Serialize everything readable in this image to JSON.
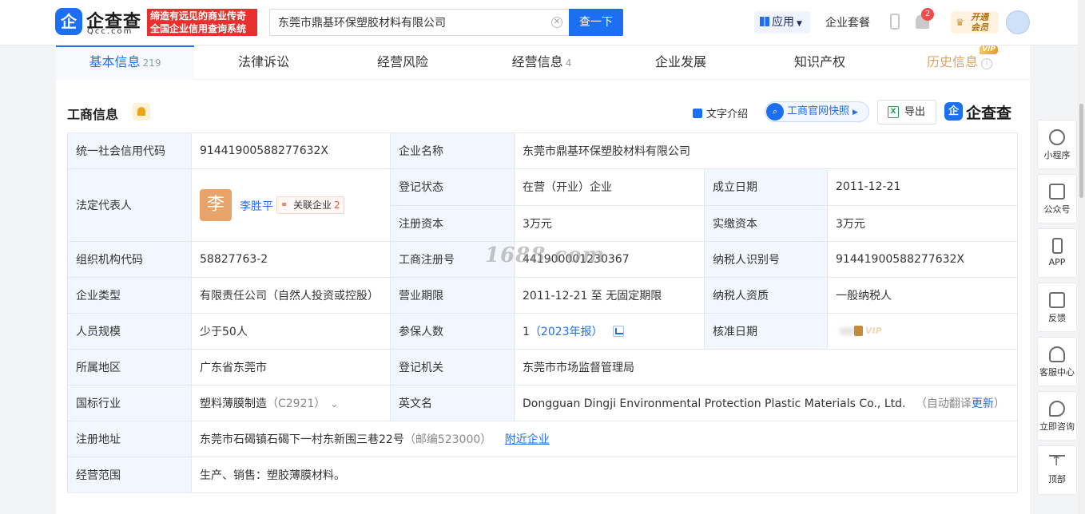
{
  "header": {
    "logo_badge": "企",
    "logo_name": "企查查",
    "logo_domain": "Qcc.com",
    "slogan_line1": "缔造有远见的商业传奇",
    "slogan_line2": "全国企业信用查询系统",
    "search_value": "东莞市鼎基环保塑胶材料有限公司",
    "search_button": "查一下",
    "apps_label": "应用",
    "package_label": "企业套餐",
    "notification_count": "2",
    "vip_line1": "开通",
    "vip_line2": "会员"
  },
  "tabs": [
    {
      "label": "基本信息",
      "count": "219"
    },
    {
      "label": "法律诉讼",
      "count": ""
    },
    {
      "label": "经营风险",
      "count": ""
    },
    {
      "label": "经营信息",
      "count": "4"
    },
    {
      "label": "企业发展",
      "count": ""
    },
    {
      "label": "知识产权",
      "count": ""
    },
    {
      "label": "历史信息",
      "count": "",
      "badge": "VIP"
    }
  ],
  "section": {
    "title": "工商信息",
    "text_intro": "文字介绍",
    "snapshot": "工商官网快照",
    "export": "导出",
    "brand": "企查查"
  },
  "table": {
    "credit_code_label": "统一社会信用代码",
    "credit_code": "91441900588277632X",
    "company_name_label": "企业名称",
    "company_name": "东莞市鼎基环保塑胶材料有限公司",
    "legal_rep_label": "法定代表人",
    "legal_rep_avatar": "李",
    "legal_rep_name": "李胜平",
    "related_label": "关联企业",
    "related_count": "2",
    "reg_status_label": "登记状态",
    "reg_status": "在营（开业）企业",
    "est_date_label": "成立日期",
    "est_date": "2011-12-21",
    "reg_capital_label": "注册资本",
    "reg_capital": "3万元",
    "paid_capital_label": "实缴资本",
    "paid_capital": "3万元",
    "org_code_label": "组织机构代码",
    "org_code": "58827763-2",
    "biz_reg_no_label": "工商注册号",
    "biz_reg_no": "441900001230367",
    "taxpayer_id_label": "纳税人识别号",
    "taxpayer_id": "91441900588277632X",
    "company_type_label": "企业类型",
    "company_type": "有限责任公司（自然人投资或控股）",
    "biz_term_label": "营业期限",
    "biz_term": "2011-12-21 至 无固定期限",
    "taxpayer_qual_label": "纳税人资质",
    "taxpayer_qual": "一般纳税人",
    "staff_size_label": "人员规模",
    "staff_size": "少于50人",
    "insured_label": "参保人数",
    "insured_count": "1",
    "insured_year": "（2023年报）",
    "approval_date_label": "核准日期",
    "approval_vip": "VIP",
    "region_label": "所属地区",
    "region": "广东省东莞市",
    "authority_label": "登记机关",
    "authority": "东莞市市场监督管理局",
    "industry_label": "国标行业",
    "industry": "塑料薄膜制造",
    "industry_code": "（C2921）",
    "english_name_label": "英文名",
    "english_name": "Dongguan Dingji Environmental Protection Plastic Materials Co., Ltd.",
    "auto_translate": "（自动翻译",
    "update_link": "更新",
    "close_paren": "）",
    "address_label": "注册地址",
    "address": "东莞市石碣镇石碣下一村东新围三巷22号",
    "postcode": "（邮编523000）",
    "nearby_link": "附近企业",
    "scope_label": "经营范围",
    "scope": "生产、销售：塑胶薄膜材料。"
  },
  "watermark": "1688.com",
  "floatbar": [
    {
      "label": "小程序",
      "icon": "mini-program-icon"
    },
    {
      "label": "公众号",
      "icon": "official-account-icon"
    },
    {
      "label": "APP",
      "icon": "phone-icon"
    },
    {
      "label": "反馈",
      "icon": "feedback-icon"
    },
    {
      "label": "客服中心",
      "icon": "headset-icon"
    },
    {
      "label": "立即咨询",
      "icon": "chat-icon"
    },
    {
      "label": "顶部",
      "icon": "back-to-top-icon"
    }
  ],
  "colors": {
    "accent": "#1d6ff2",
    "label_bg": "#f2f7ff",
    "slogan_red": "#e8312f"
  }
}
